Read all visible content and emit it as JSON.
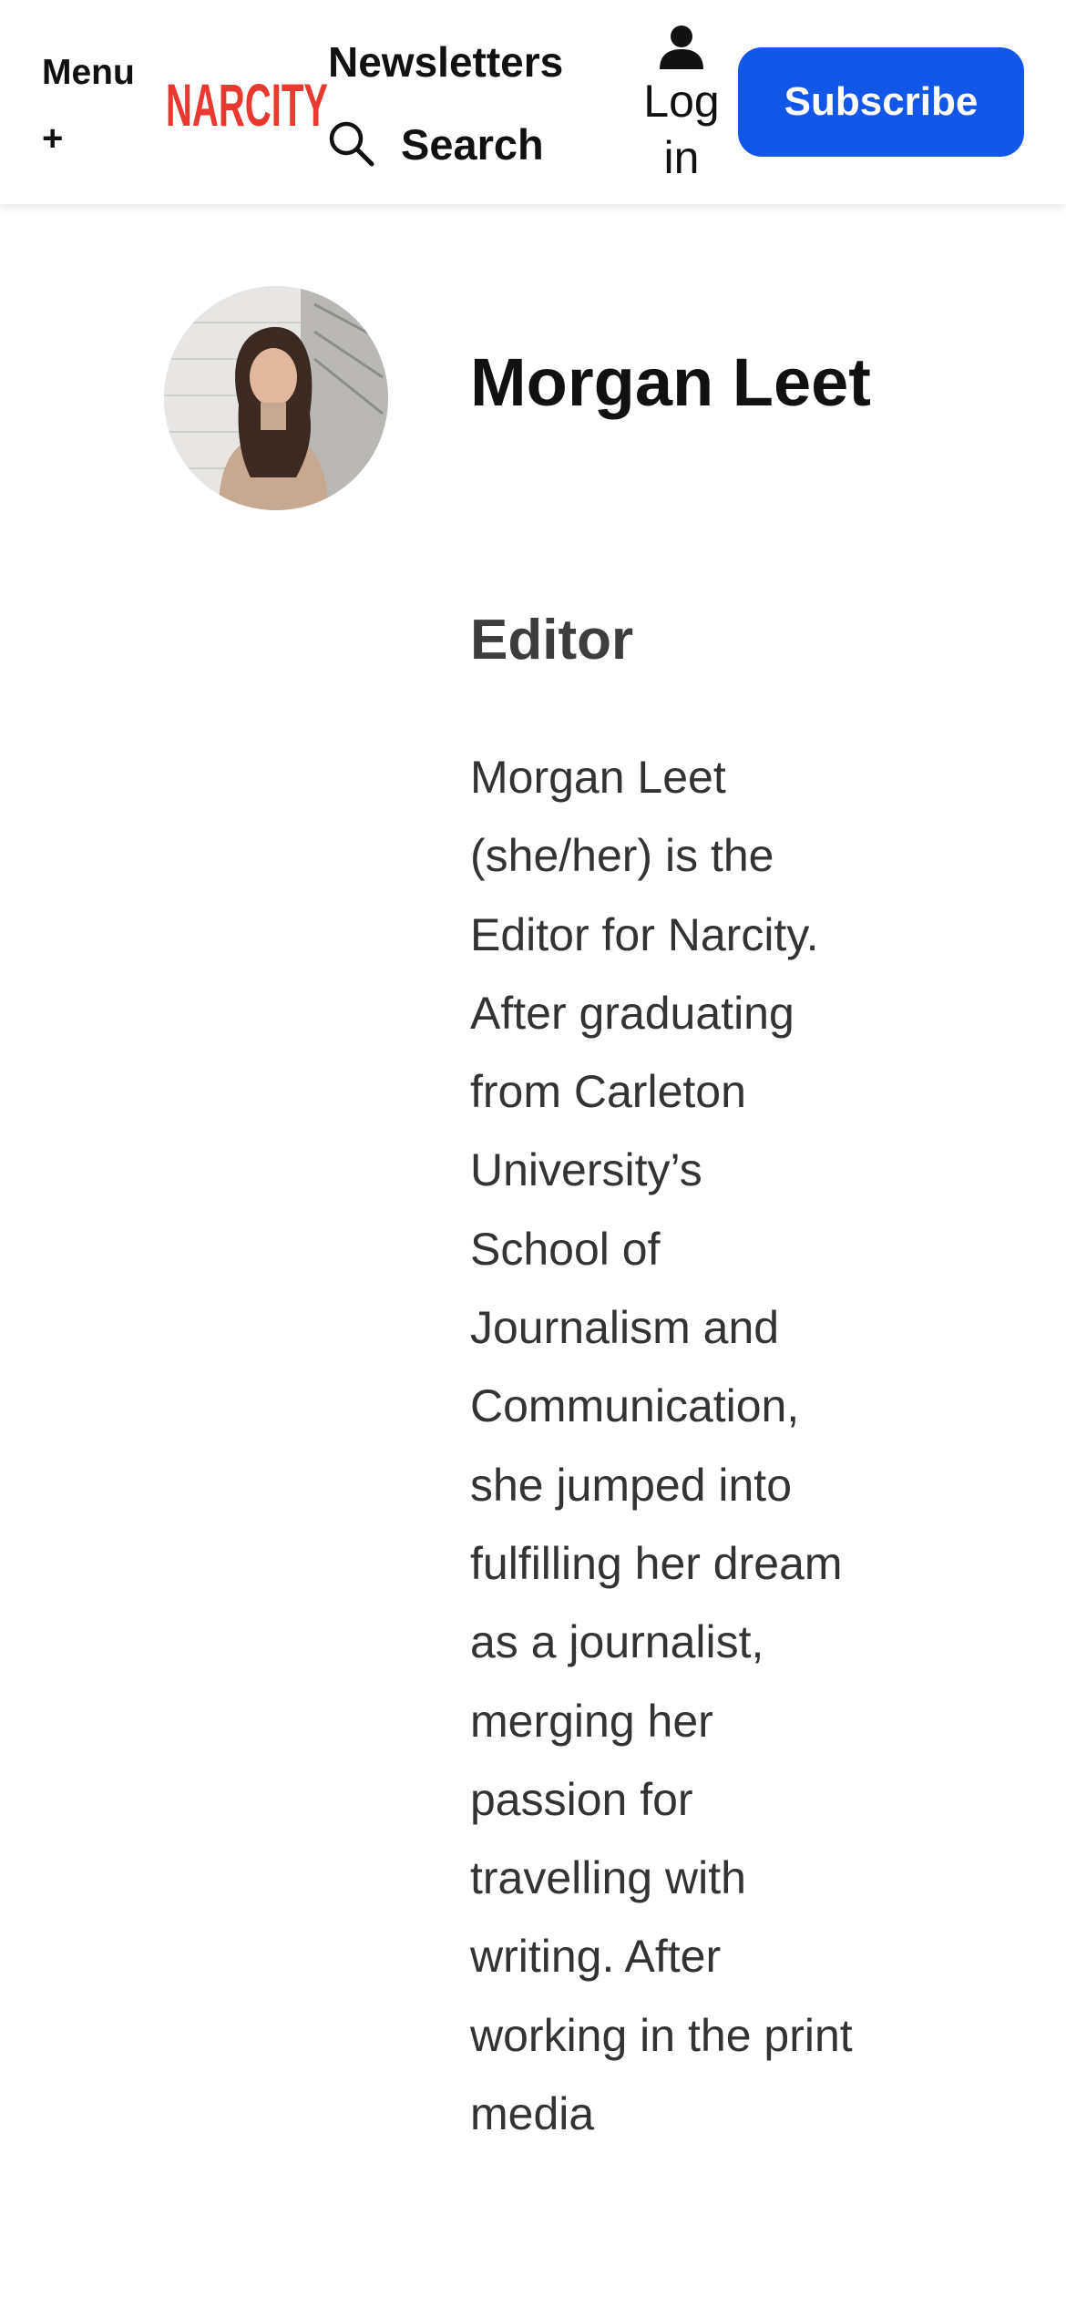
{
  "header": {
    "menu_label": "Menu",
    "menu_plus": "+",
    "logo_text": "NARCITY",
    "newsletters_label": "Newsletters",
    "search_label": "Search",
    "login_label": "Log in",
    "subscribe_label": "Subscribe",
    "brand_color": "#e8382f",
    "accent_color": "#1257ea"
  },
  "author": {
    "name": "Morgan Leet",
    "role": "Editor",
    "bio": "Morgan Leet (she/her) is the Editor for Narcity. After graduating from Carleton University’s School of Journalism and Communication, she jumped into fulfilling her dream as a journalist, merging her passion for travelling with writing. After working in the print media"
  }
}
